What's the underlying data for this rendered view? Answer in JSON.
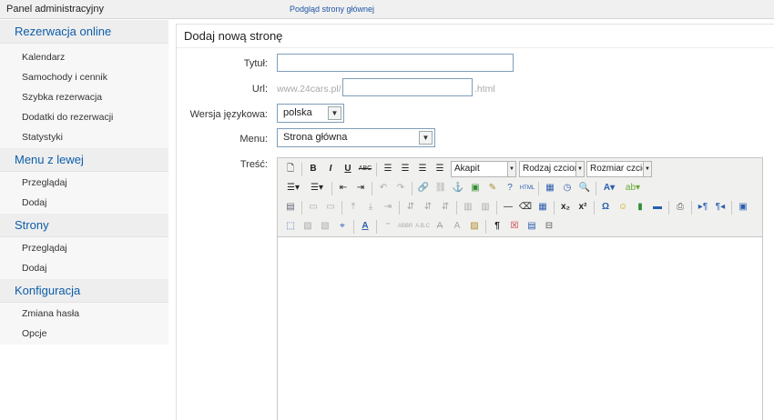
{
  "topbar": {
    "brand": "Panel administracyjny",
    "preview_link": "Podgląd strony głównej"
  },
  "sidebar": {
    "sections": [
      {
        "title": "Rezerwacja online",
        "items": [
          "Kalendarz",
          "Samochody i cennik",
          "Szybka rezerwacja",
          "Dodatki do rezerwacji",
          "Statystyki"
        ]
      },
      {
        "title": "Menu z lewej",
        "items": [
          "Przeglądaj",
          "Dodaj"
        ]
      },
      {
        "title": "Strony",
        "items": [
          "Przeglądaj",
          "Dodaj"
        ]
      },
      {
        "title": "Konfiguracja",
        "items": [
          "Zmiana hasła",
          "Opcje"
        ]
      }
    ]
  },
  "main": {
    "title": "Dodaj nową stronę",
    "form": {
      "title_label": "Tytuł:",
      "title_value": "",
      "url_label": "Url:",
      "url_prefix": "www.24cars.pl/",
      "url_value": "",
      "url_suffix": ".html",
      "lang_label": "Wersja językowa:",
      "lang_value": "polska",
      "menu_label": "Menu:",
      "menu_value": "Strona główna",
      "content_label": "Treść:"
    },
    "editor": {
      "format_select": "Akapit",
      "font_select": "Rodzaj czcionki",
      "size_select": "Rozmiar czcionki",
      "content": ""
    }
  },
  "colors": {
    "accent": "#0e5da9",
    "link": "#1f55a6",
    "section_bg": "#eeeeee",
    "toolbar_bg": "#f0f0ee"
  }
}
